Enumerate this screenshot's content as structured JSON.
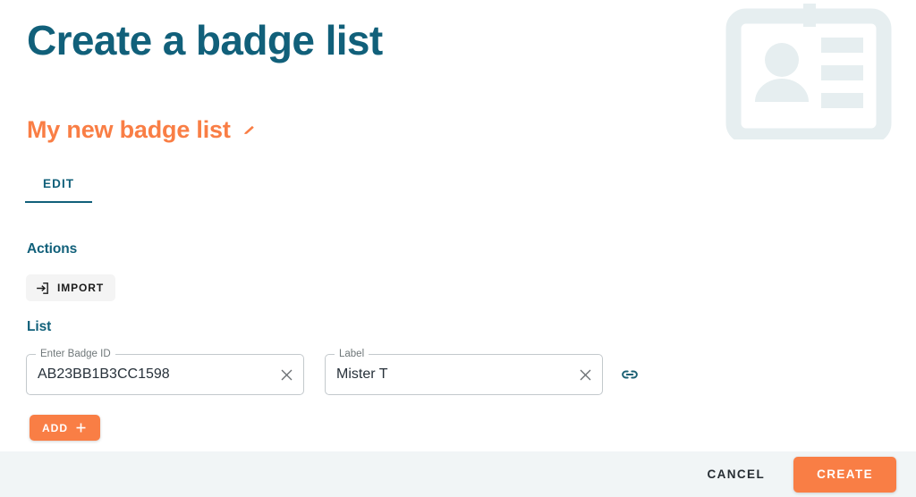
{
  "header": {
    "title": "Create a badge list",
    "list_name": "My new badge list",
    "edit_name_icon": "pencil-icon",
    "illustration_icon": "id-badge-card-icon"
  },
  "tabs": [
    {
      "label": "EDIT",
      "active": true
    }
  ],
  "sections": {
    "actions": {
      "heading": "Actions",
      "import_button": {
        "label": "IMPORT",
        "icon": "import-arrow-into-box-icon"
      }
    },
    "list": {
      "heading": "List",
      "rows": [
        {
          "badge_id": {
            "label": "Enter Badge ID",
            "value": "AB23BB1B3CC1598",
            "placeholder": "Enter Badge ID",
            "clear_icon": "close-x-icon"
          },
          "label_field": {
            "label": "Label",
            "value": "Mister T",
            "placeholder": "Label",
            "clear_icon": "close-x-icon"
          },
          "link_icon": "chain-link-icon"
        }
      ],
      "add_button": {
        "label": "ADD",
        "icon": "plus-icon"
      }
    }
  },
  "footer": {
    "cancel_label": "CANCEL",
    "create_label": "CREATE"
  },
  "colors": {
    "teal": "#11607a",
    "orange": "#f97e45",
    "footer_background": "#f1f5f6",
    "illustration": "#e6eef0",
    "field_border": "#c3c9cc"
  }
}
